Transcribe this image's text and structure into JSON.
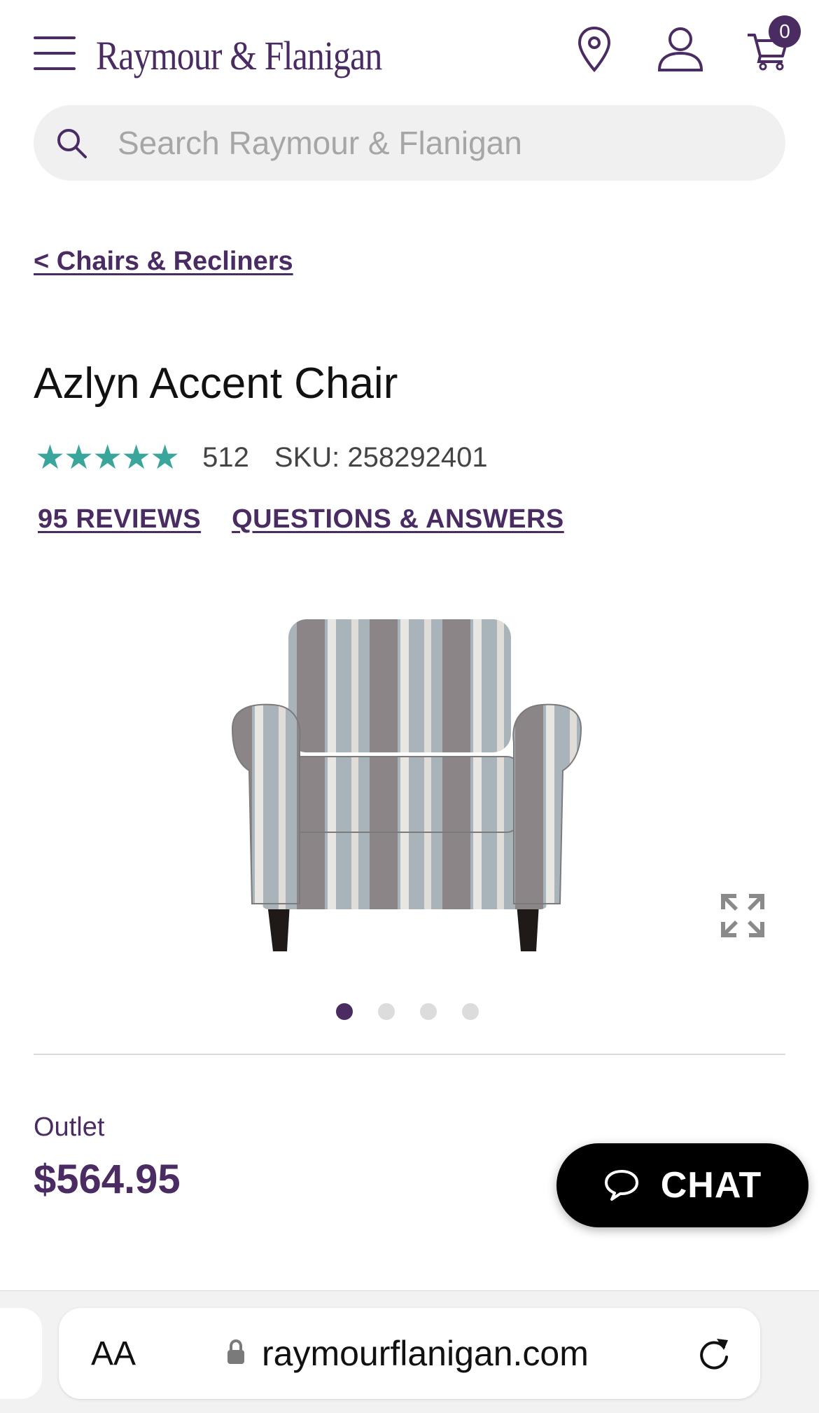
{
  "header": {
    "brand": "Raymour & Flanigan",
    "cart_count": "0",
    "icons": [
      "menu-icon",
      "map-pin-icon",
      "user-icon",
      "cart-icon"
    ]
  },
  "search": {
    "placeholder": "Search Raymour & Flanigan"
  },
  "breadcrumb": "< Chairs & Recliners",
  "product": {
    "title": "Azlyn Accent Chair",
    "stars": "★★★★★",
    "rating_count": "512",
    "sku": "SKU: 258292401",
    "reviews_link": "95 REVIEWS",
    "qa_link": "QUESTIONS & ANSWERS",
    "price_label": "Outlet",
    "price": "$564.95"
  },
  "gallery": {
    "total": 4,
    "active": 1
  },
  "chat": {
    "label": "CHAT"
  },
  "browser": {
    "text_size": "AA",
    "url": "raymourflanigan.com"
  },
  "colors": {
    "brand": "#4a2c63",
    "stars": "#3aa59b"
  }
}
